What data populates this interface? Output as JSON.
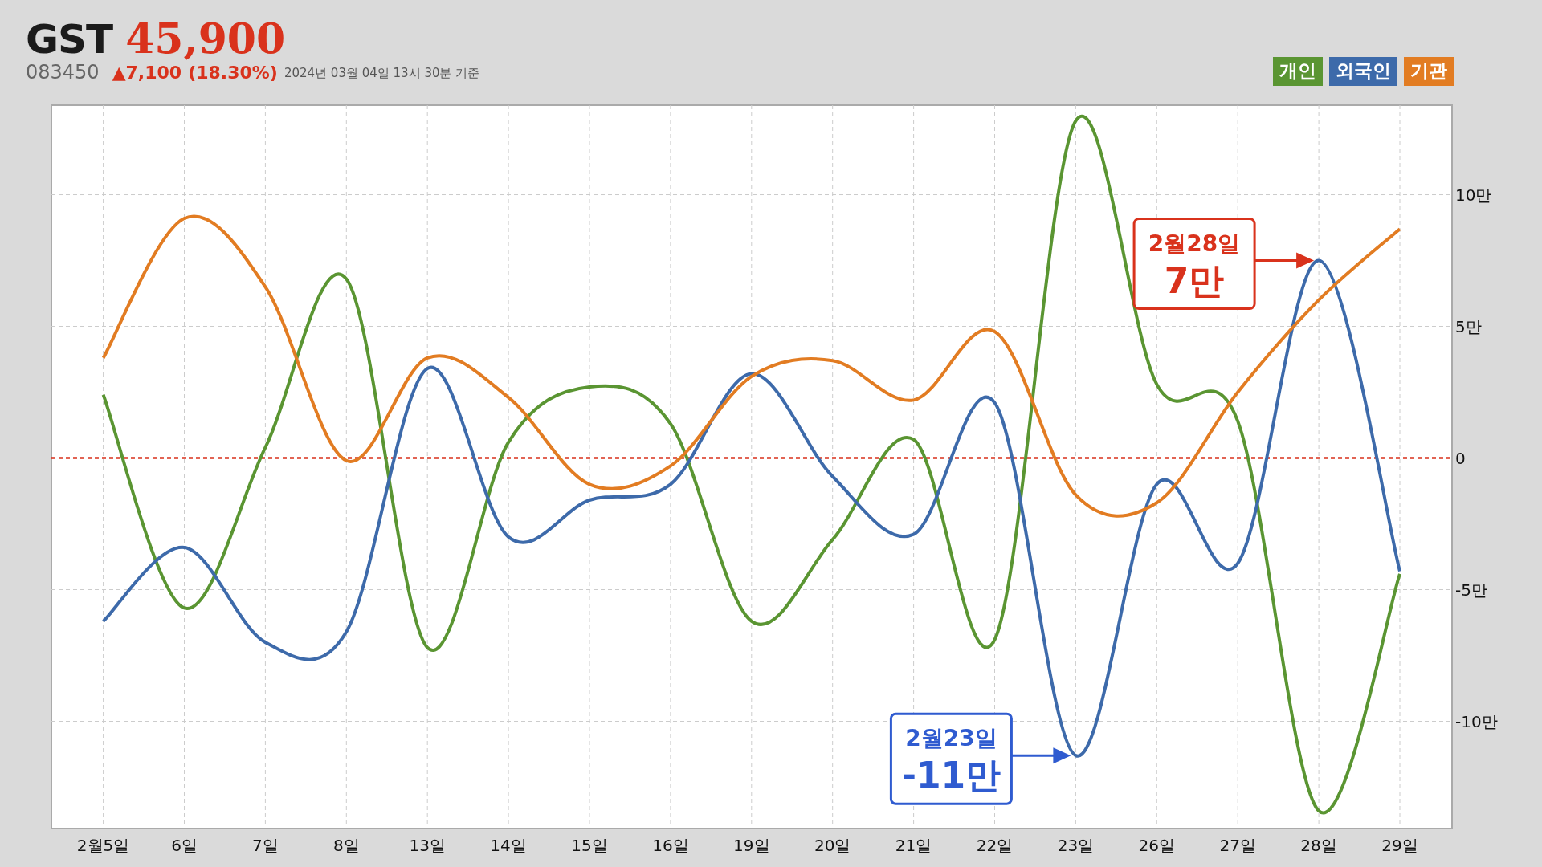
{
  "stock": {
    "name": "GST",
    "price": "45,900",
    "code": "083450",
    "change": "▲7,100",
    "change_percent": "(18.30%)",
    "timestamp": "2024년 03월 04일 13시 30분 기준"
  },
  "chart_data": {
    "type": "line",
    "categories": [
      "2월5일",
      "6일",
      "7일",
      "8일",
      "13일",
      "14일",
      "15일",
      "16일",
      "19일",
      "20일",
      "21일",
      "22일",
      "23일",
      "26일",
      "27일",
      "28일",
      "29일"
    ],
    "series": [
      {
        "name": "개인",
        "color": "#5a9532",
        "values": [
          2.4,
          -5.7,
          0.4,
          6.8,
          -7.2,
          0.6,
          2.7,
          1.3,
          -6.2,
          -3.1,
          0.7,
          -6.9,
          12.8,
          2.8,
          1.4,
          -13.4,
          -4.4
        ]
      },
      {
        "name": "외국인",
        "color": "#3d6aaa",
        "values": [
          -6.2,
          -3.4,
          -7.0,
          -6.6,
          3.4,
          -3.0,
          -1.6,
          -1.0,
          3.2,
          -0.7,
          -2.9,
          2.1,
          -11.3,
          -1.0,
          -4.0,
          7.5,
          -4.3
        ]
      },
      {
        "name": "기관",
        "color": "#e27c22",
        "values": [
          3.8,
          9.1,
          6.5,
          -0.1,
          3.8,
          2.3,
          -1.0,
          -0.3,
          3.1,
          3.7,
          2.2,
          4.8,
          -1.4,
          -1.7,
          2.5,
          6.0,
          8.7
        ]
      }
    ],
    "ylim": [
      -14.07,
      13.4
    ],
    "grid": true,
    "ref_lines": [
      {
        "axis": "y",
        "value": 0,
        "color": "#d9321c"
      }
    ],
    "yticks": [
      {
        "value": -10,
        "label": "-10만"
      },
      {
        "value": -5,
        "label": "-5만"
      },
      0,
      {
        "value": 5,
        "label": "5만"
      },
      {
        "value": 10,
        "label": "10만"
      }
    ]
  },
  "callouts": [
    {
      "date": "2월28일",
      "amount": "7만",
      "color": "#d9321c"
    },
    {
      "date": "2월23일",
      "amount": "-11만",
      "color": "#2f5bd0"
    }
  ]
}
